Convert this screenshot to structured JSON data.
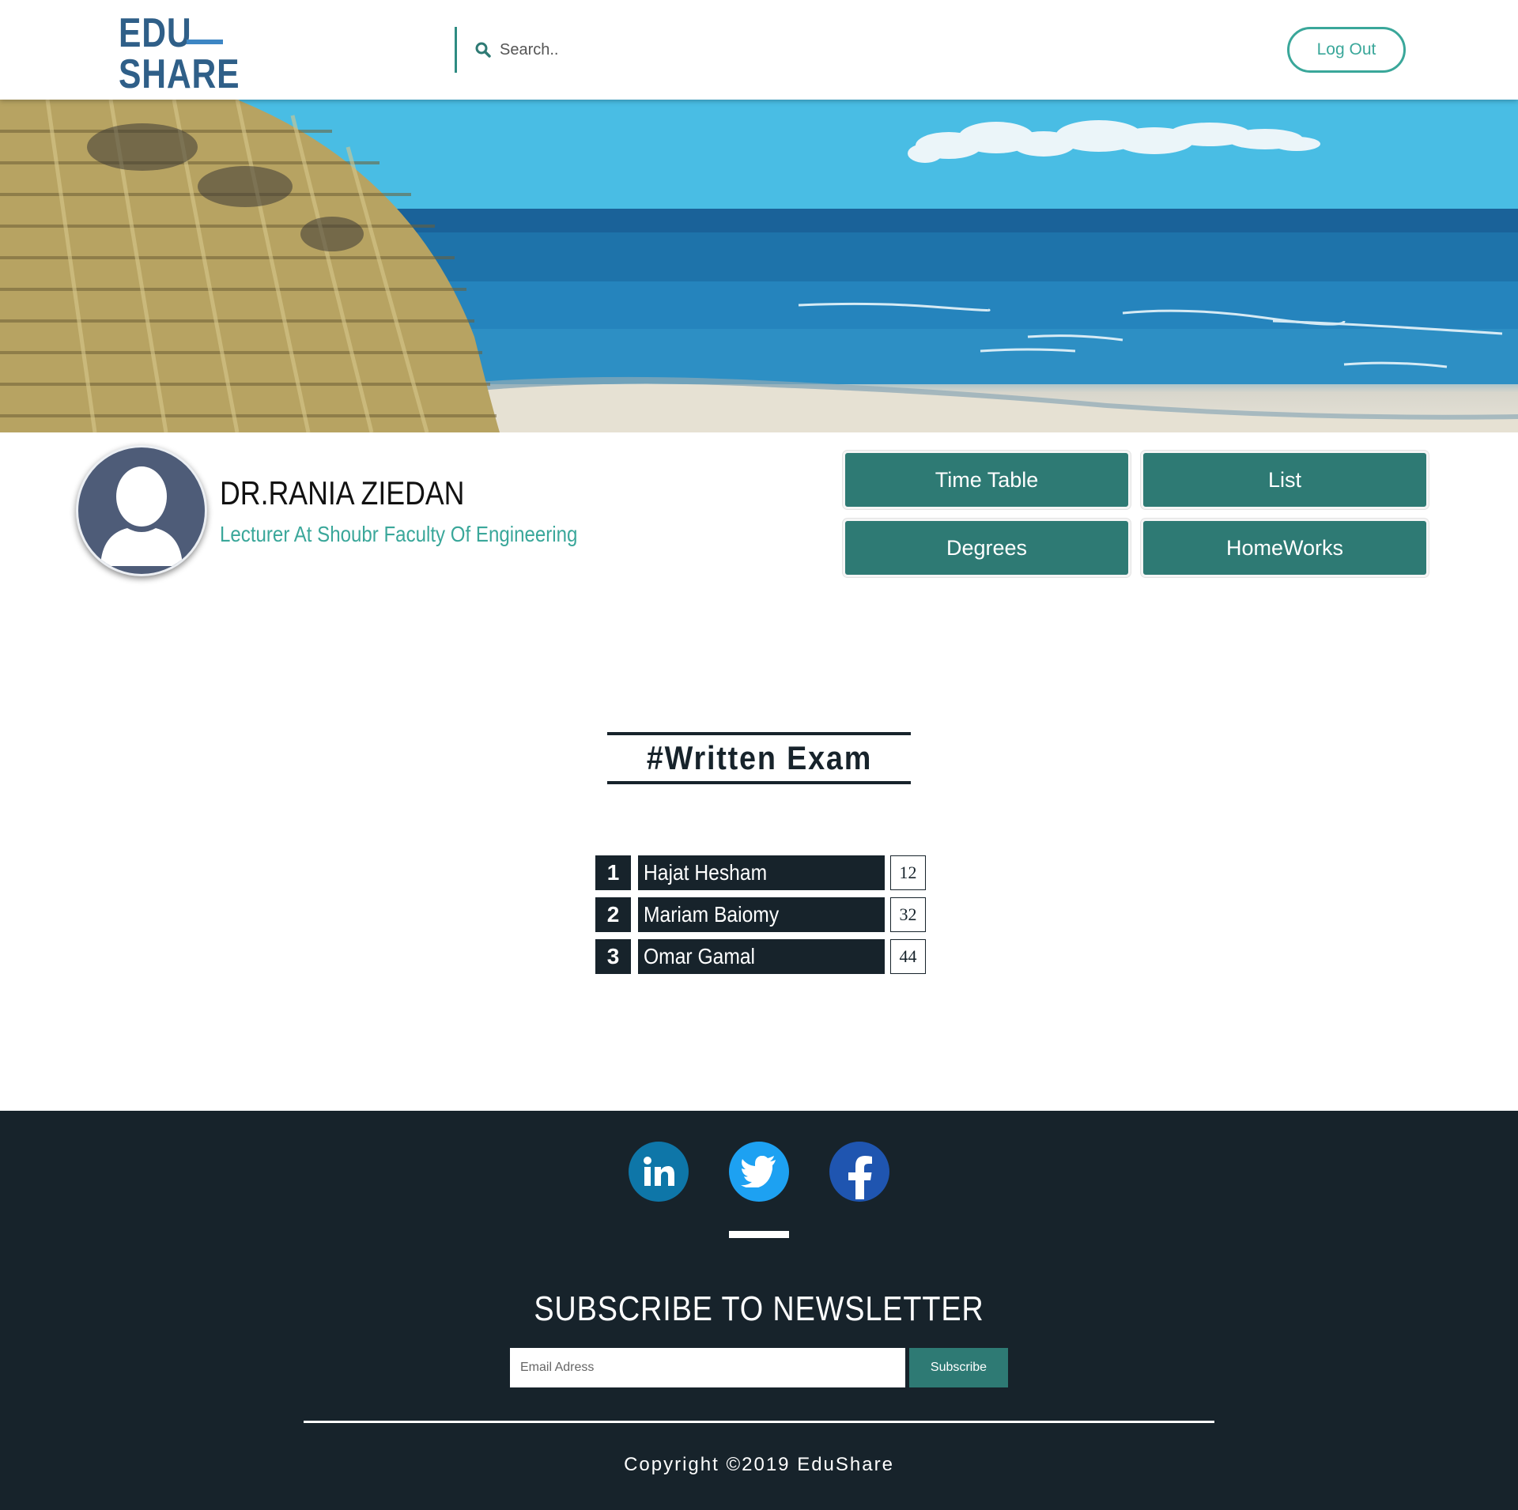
{
  "header": {
    "logo_top": "EDU",
    "logo_bottom": "SHARE",
    "search_placeholder": "Search..",
    "logout_label": "Log Out"
  },
  "profile": {
    "name": "DR.RANIA ZIEDAN",
    "role": "Lecturer At Shoubr Faculty Of Engineering"
  },
  "nav": {
    "buttons": [
      "Time Table",
      "List",
      "Degrees",
      "HomeWorks"
    ]
  },
  "section": {
    "title": "#Written Exam"
  },
  "ranking": [
    {
      "rank": "1",
      "name": "Hajat Hesham",
      "score": "12"
    },
    {
      "rank": "2",
      "name": "Mariam Baiomy",
      "score": "32"
    },
    {
      "rank": "3",
      "name": "Omar Gamal",
      "score": "44"
    }
  ],
  "footer": {
    "social": [
      "linkedin-icon",
      "twitter-icon",
      "facebook-icon"
    ],
    "newsletter_title": "SUBSCRIBE TO NEWSLETTER",
    "email_placeholder": "Email Adress",
    "subscribe_label": "Subscribe",
    "copyright": "Copyright ©2019 EduShare"
  },
  "colors": {
    "brand": "#2f5f88",
    "accent": "#3aa79a",
    "button": "#2e7a74",
    "dark": "#17232b"
  }
}
